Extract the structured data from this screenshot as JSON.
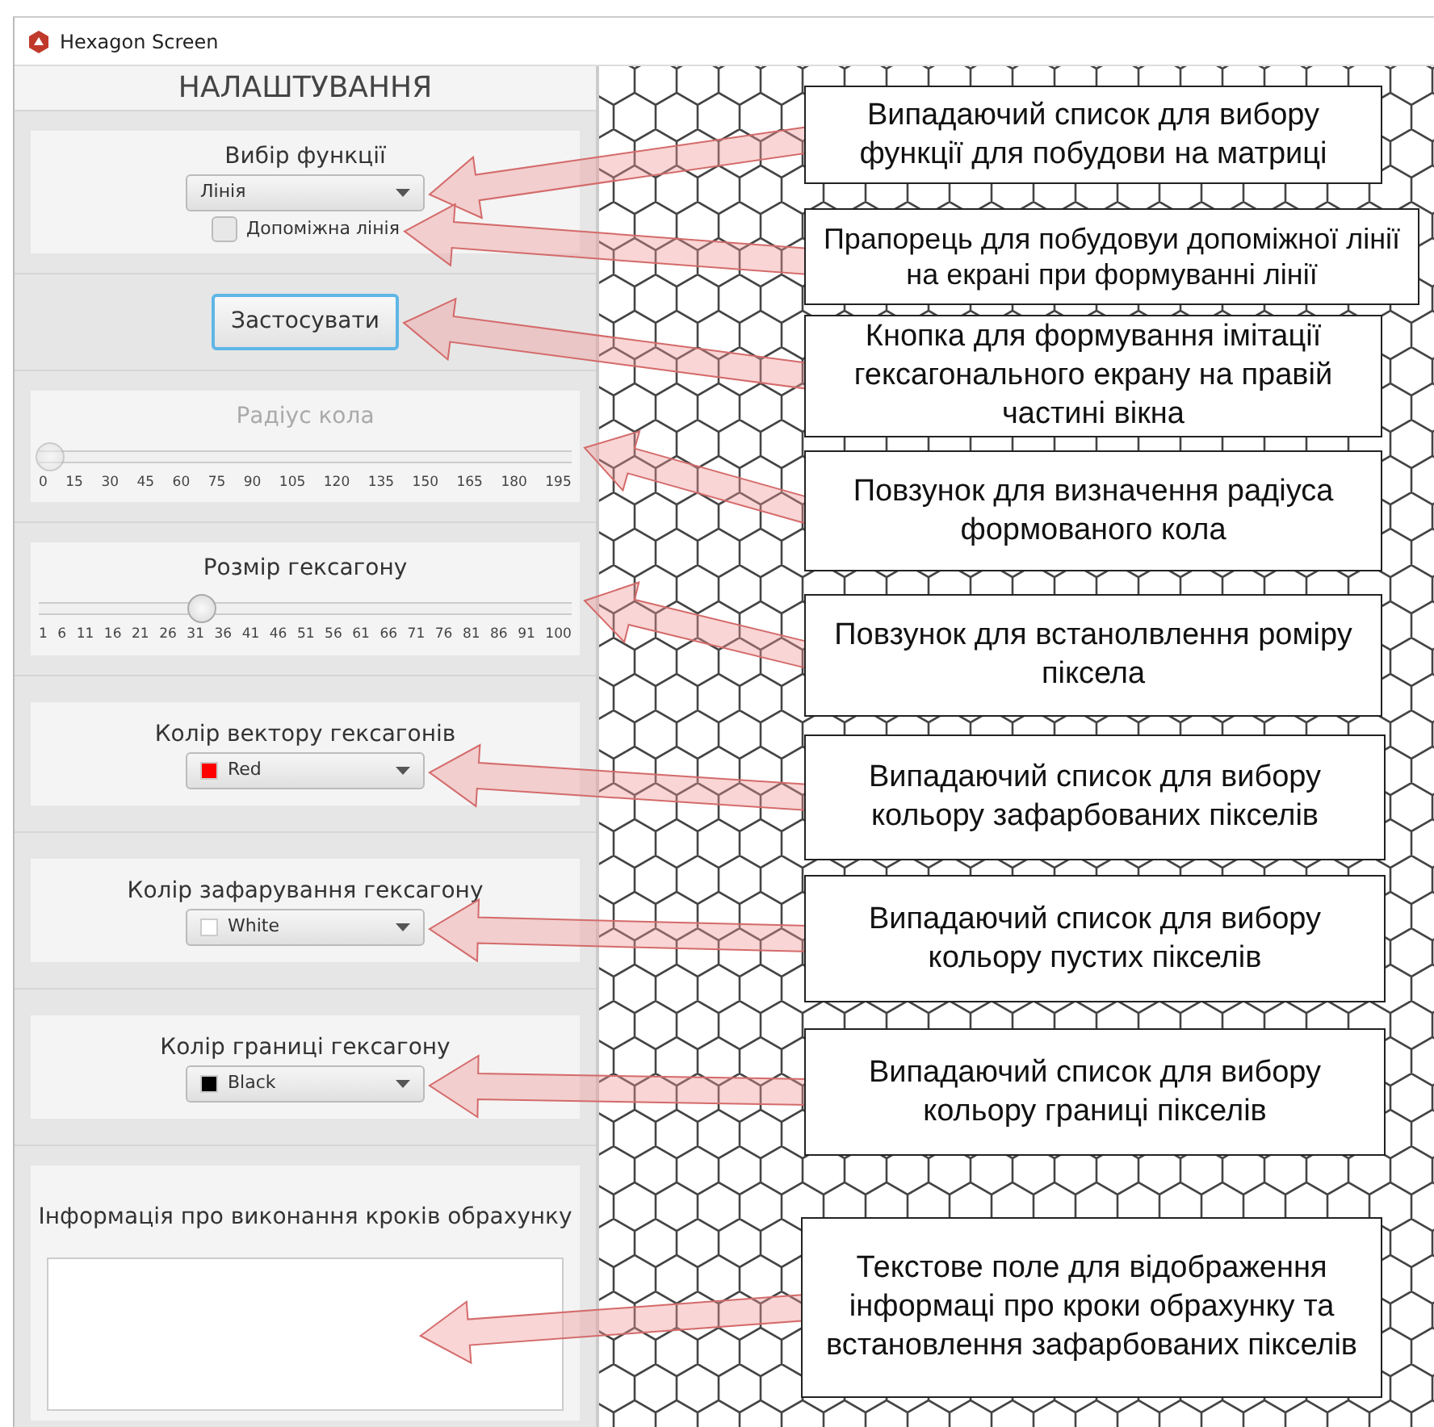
{
  "window": {
    "title": "Hexagon Screen"
  },
  "settings": {
    "title": "НАЛАШТУВАННЯ",
    "function_select": {
      "label": "Вибір функції",
      "value": "Лінія"
    },
    "helper_line": {
      "label": "Допоміжна лінія",
      "checked": false
    },
    "apply_button": {
      "label": "Застосувати"
    },
    "sliders": [
      {
        "label": "Радіус кола",
        "disabled": true,
        "level": 0.0,
        "ticks": [
          "0",
          "15",
          "30",
          "45",
          "60",
          "75",
          "90",
          "105",
          "120",
          "135",
          "150",
          "165",
          "180",
          "195"
        ]
      },
      {
        "label": "Розмір гексагону",
        "disabled": false,
        "level": 0.3,
        "ticks": [
          "1",
          "6",
          "11",
          "16",
          "21",
          "26",
          "31",
          "36",
          "41",
          "46",
          "51",
          "56",
          "61",
          "66",
          "71",
          "76",
          "81",
          "86",
          "91",
          "100"
        ]
      }
    ],
    "color_selects": [
      {
        "label": "Колір вектору гексагонів",
        "value": "Red",
        "color": "#ff0000"
      },
      {
        "label": "Колір зафарування гексагону",
        "value": "White",
        "color": "#ffffff"
      },
      {
        "label": "Колір границі гексагону",
        "value": "Black",
        "color": "#000000"
      }
    ],
    "info": {
      "label": "Інформація про виконання кроків обрахунку"
    }
  },
  "annotations": [
    {
      "text": "Випадаючий список для вибору функції для побудови на матриці"
    },
    {
      "text": "Прапорець для побудовуи допоміжної лінії на екрані при формуванні лінії"
    },
    {
      "text": "Кнопка для формування імітації гексагонального екрану на правій частині вікна"
    },
    {
      "text": "Повзунок для визначення радіуса формованого кола"
    },
    {
      "text": "Повзунок для встанолвлення роміру піксела"
    },
    {
      "text": "Випадаючий список для вибору кольору зафарбованих пікселів"
    },
    {
      "text": "Випадаючий список для вибору кольору пустих пікселів"
    },
    {
      "text": "Випадаючий список для вибору кольору границі пікселів"
    },
    {
      "text": "Текстове поле для відображення інформаці про кроки обрахунку та встановлення зафарбованих пікселів"
    }
  ]
}
